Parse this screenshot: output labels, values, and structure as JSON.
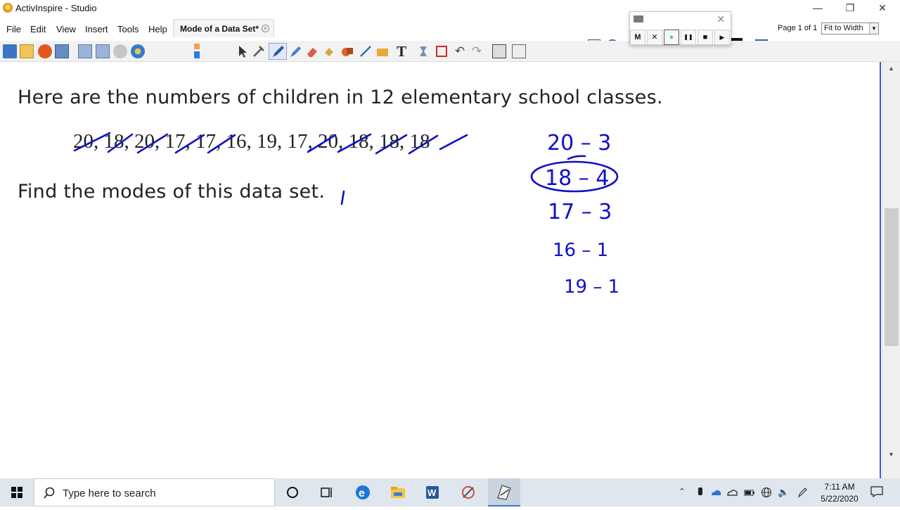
{
  "window": {
    "title": "ActivInspire - Studio",
    "minimize": "—",
    "maximize": "❐",
    "close": "✕"
  },
  "menu": [
    "File",
    "Edit",
    "View",
    "Insert",
    "Tools",
    "Help"
  ],
  "document_tab": {
    "label": "Mode of a Data Set*",
    "close": "×"
  },
  "page_indicator": "Page 1 of 1",
  "zoom": "Fit to Width",
  "recorder": {
    "buttons": [
      "M",
      "✕",
      "●",
      "❚❚",
      "■",
      "▶"
    ]
  },
  "palette_colors": [
    "#ff0000",
    "#ff8c00",
    "#ffff00",
    "#00cc00",
    "#0000ff",
    "#ff00ff",
    "#000000",
    "#ffffff"
  ],
  "canvas": {
    "heading": "Here are the numbers of children in 12 elementary school classes.",
    "data_set": [
      "20",
      "18",
      "20",
      "17",
      "17",
      "16",
      "19",
      "17",
      "20",
      "18",
      "18",
      "18"
    ],
    "question": "Find the modes of this data set.",
    "handwritten_tally": [
      "20 – 3",
      "18 – 4",
      "17 – 3",
      "16 – 1",
      "19 – 1"
    ],
    "circled_entry": "18 – 4",
    "ink_color": "#1010c8"
  },
  "taskbar": {
    "search_placeholder": "Type here to search",
    "time": "7:11 AM",
    "date": "5/22/2020"
  }
}
